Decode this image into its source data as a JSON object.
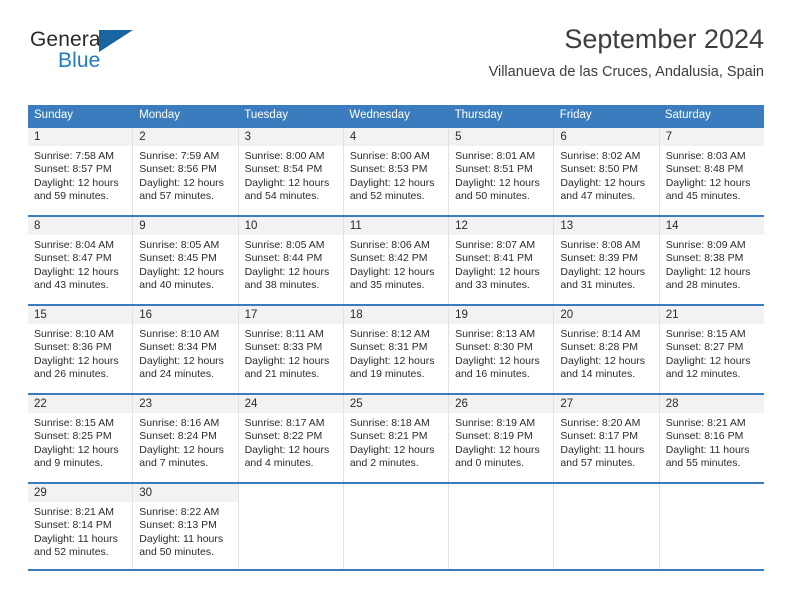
{
  "brand": {
    "line1": "General",
    "line2": "Blue",
    "triangle_color": "#19659f",
    "blue_color": "#1f7bc1"
  },
  "header": {
    "title": "September 2024",
    "subtitle": "Villanueva de las Cruces, Andalusia, Spain"
  },
  "calendar": {
    "accent_color": "#3a7cbe",
    "day_headers": [
      "Sunday",
      "Monday",
      "Tuesday",
      "Wednesday",
      "Thursday",
      "Friday",
      "Saturday"
    ],
    "weeks": [
      [
        {
          "day": "1",
          "sunrise": "Sunrise: 7:58 AM",
          "sunset": "Sunset: 8:57 PM",
          "daylight_line1": "Daylight: 12 hours",
          "daylight_line2": "and 59 minutes."
        },
        {
          "day": "2",
          "sunrise": "Sunrise: 7:59 AM",
          "sunset": "Sunset: 8:56 PM",
          "daylight_line1": "Daylight: 12 hours",
          "daylight_line2": "and 57 minutes."
        },
        {
          "day": "3",
          "sunrise": "Sunrise: 8:00 AM",
          "sunset": "Sunset: 8:54 PM",
          "daylight_line1": "Daylight: 12 hours",
          "daylight_line2": "and 54 minutes."
        },
        {
          "day": "4",
          "sunrise": "Sunrise: 8:00 AM",
          "sunset": "Sunset: 8:53 PM",
          "daylight_line1": "Daylight: 12 hours",
          "daylight_line2": "and 52 minutes."
        },
        {
          "day": "5",
          "sunrise": "Sunrise: 8:01 AM",
          "sunset": "Sunset: 8:51 PM",
          "daylight_line1": "Daylight: 12 hours",
          "daylight_line2": "and 50 minutes."
        },
        {
          "day": "6",
          "sunrise": "Sunrise: 8:02 AM",
          "sunset": "Sunset: 8:50 PM",
          "daylight_line1": "Daylight: 12 hours",
          "daylight_line2": "and 47 minutes."
        },
        {
          "day": "7",
          "sunrise": "Sunrise: 8:03 AM",
          "sunset": "Sunset: 8:48 PM",
          "daylight_line1": "Daylight: 12 hours",
          "daylight_line2": "and 45 minutes."
        }
      ],
      [
        {
          "day": "8",
          "sunrise": "Sunrise: 8:04 AM",
          "sunset": "Sunset: 8:47 PM",
          "daylight_line1": "Daylight: 12 hours",
          "daylight_line2": "and 43 minutes."
        },
        {
          "day": "9",
          "sunrise": "Sunrise: 8:05 AM",
          "sunset": "Sunset: 8:45 PM",
          "daylight_line1": "Daylight: 12 hours",
          "daylight_line2": "and 40 minutes."
        },
        {
          "day": "10",
          "sunrise": "Sunrise: 8:05 AM",
          "sunset": "Sunset: 8:44 PM",
          "daylight_line1": "Daylight: 12 hours",
          "daylight_line2": "and 38 minutes."
        },
        {
          "day": "11",
          "sunrise": "Sunrise: 8:06 AM",
          "sunset": "Sunset: 8:42 PM",
          "daylight_line1": "Daylight: 12 hours",
          "daylight_line2": "and 35 minutes."
        },
        {
          "day": "12",
          "sunrise": "Sunrise: 8:07 AM",
          "sunset": "Sunset: 8:41 PM",
          "daylight_line1": "Daylight: 12 hours",
          "daylight_line2": "and 33 minutes."
        },
        {
          "day": "13",
          "sunrise": "Sunrise: 8:08 AM",
          "sunset": "Sunset: 8:39 PM",
          "daylight_line1": "Daylight: 12 hours",
          "daylight_line2": "and 31 minutes."
        },
        {
          "day": "14",
          "sunrise": "Sunrise: 8:09 AM",
          "sunset": "Sunset: 8:38 PM",
          "daylight_line1": "Daylight: 12 hours",
          "daylight_line2": "and 28 minutes."
        }
      ],
      [
        {
          "day": "15",
          "sunrise": "Sunrise: 8:10 AM",
          "sunset": "Sunset: 8:36 PM",
          "daylight_line1": "Daylight: 12 hours",
          "daylight_line2": "and 26 minutes."
        },
        {
          "day": "16",
          "sunrise": "Sunrise: 8:10 AM",
          "sunset": "Sunset: 8:34 PM",
          "daylight_line1": "Daylight: 12 hours",
          "daylight_line2": "and 24 minutes."
        },
        {
          "day": "17",
          "sunrise": "Sunrise: 8:11 AM",
          "sunset": "Sunset: 8:33 PM",
          "daylight_line1": "Daylight: 12 hours",
          "daylight_line2": "and 21 minutes."
        },
        {
          "day": "18",
          "sunrise": "Sunrise: 8:12 AM",
          "sunset": "Sunset: 8:31 PM",
          "daylight_line1": "Daylight: 12 hours",
          "daylight_line2": "and 19 minutes."
        },
        {
          "day": "19",
          "sunrise": "Sunrise: 8:13 AM",
          "sunset": "Sunset: 8:30 PM",
          "daylight_line1": "Daylight: 12 hours",
          "daylight_line2": "and 16 minutes."
        },
        {
          "day": "20",
          "sunrise": "Sunrise: 8:14 AM",
          "sunset": "Sunset: 8:28 PM",
          "daylight_line1": "Daylight: 12 hours",
          "daylight_line2": "and 14 minutes."
        },
        {
          "day": "21",
          "sunrise": "Sunrise: 8:15 AM",
          "sunset": "Sunset: 8:27 PM",
          "daylight_line1": "Daylight: 12 hours",
          "daylight_line2": "and 12 minutes."
        }
      ],
      [
        {
          "day": "22",
          "sunrise": "Sunrise: 8:15 AM",
          "sunset": "Sunset: 8:25 PM",
          "daylight_line1": "Daylight: 12 hours",
          "daylight_line2": "and 9 minutes."
        },
        {
          "day": "23",
          "sunrise": "Sunrise: 8:16 AM",
          "sunset": "Sunset: 8:24 PM",
          "daylight_line1": "Daylight: 12 hours",
          "daylight_line2": "and 7 minutes."
        },
        {
          "day": "24",
          "sunrise": "Sunrise: 8:17 AM",
          "sunset": "Sunset: 8:22 PM",
          "daylight_line1": "Daylight: 12 hours",
          "daylight_line2": "and 4 minutes."
        },
        {
          "day": "25",
          "sunrise": "Sunrise: 8:18 AM",
          "sunset": "Sunset: 8:21 PM",
          "daylight_line1": "Daylight: 12 hours",
          "daylight_line2": "and 2 minutes."
        },
        {
          "day": "26",
          "sunrise": "Sunrise: 8:19 AM",
          "sunset": "Sunset: 8:19 PM",
          "daylight_line1": "Daylight: 12 hours",
          "daylight_line2": "and 0 minutes."
        },
        {
          "day": "27",
          "sunrise": "Sunrise: 8:20 AM",
          "sunset": "Sunset: 8:17 PM",
          "daylight_line1": "Daylight: 11 hours",
          "daylight_line2": "and 57 minutes."
        },
        {
          "day": "28",
          "sunrise": "Sunrise: 8:21 AM",
          "sunset": "Sunset: 8:16 PM",
          "daylight_line1": "Daylight: 11 hours",
          "daylight_line2": "and 55 minutes."
        }
      ],
      [
        {
          "day": "29",
          "sunrise": "Sunrise: 8:21 AM",
          "sunset": "Sunset: 8:14 PM",
          "daylight_line1": "Daylight: 11 hours",
          "daylight_line2": "and 52 minutes."
        },
        {
          "day": "30",
          "sunrise": "Sunrise: 8:22 AM",
          "sunset": "Sunset: 8:13 PM",
          "daylight_line1": "Daylight: 11 hours",
          "daylight_line2": "and 50 minutes."
        },
        {
          "day": "",
          "sunrise": "",
          "sunset": "",
          "daylight_line1": "",
          "daylight_line2": ""
        },
        {
          "day": "",
          "sunrise": "",
          "sunset": "",
          "daylight_line1": "",
          "daylight_line2": ""
        },
        {
          "day": "",
          "sunrise": "",
          "sunset": "",
          "daylight_line1": "",
          "daylight_line2": ""
        },
        {
          "day": "",
          "sunrise": "",
          "sunset": "",
          "daylight_line1": "",
          "daylight_line2": ""
        },
        {
          "day": "",
          "sunrise": "",
          "sunset": "",
          "daylight_line1": "",
          "daylight_line2": ""
        }
      ]
    ]
  }
}
